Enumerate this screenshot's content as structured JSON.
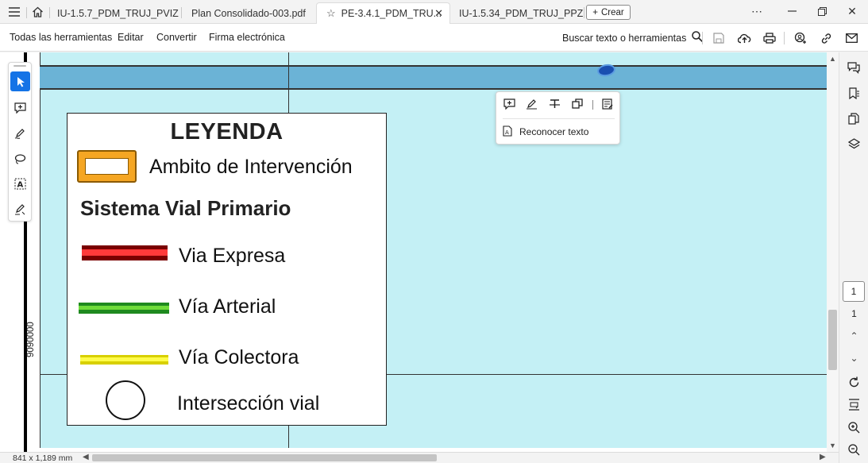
{
  "tabs": [
    {
      "label": "IU-1.5.7_PDM_TRUJ_PVIZ...",
      "active": false
    },
    {
      "label": "Plan Consolidado-003.pdf",
      "active": false
    },
    {
      "label": "PE-3.4.1_PDM_TRU...",
      "active": true
    },
    {
      "label": "IU-1.5.34_PDM_TRUJ_PPZ...",
      "active": false
    }
  ],
  "crear_label": "Crear",
  "menu": {
    "all_tools": "Todas las herramientas",
    "edit": "Editar",
    "convert": "Convertir",
    "esign": "Firma electrónica"
  },
  "search_label": "Buscar texto o herramientas",
  "document": {
    "coordinate_label": "9090000",
    "legend": {
      "title": "LEYENDA",
      "ambito": "Ambito de Intervención",
      "section_title": "Sistema Vial Primario",
      "expresa": "Via Expresa",
      "arterial": "Vía Arterial",
      "colectora": "Vía Colectora",
      "interseccion": "Intersección vial"
    }
  },
  "float_toolbar": {
    "ocr_label": "Reconocer texto"
  },
  "pagination": {
    "current": "1",
    "total": "1"
  },
  "status": {
    "page_size": "841 x 1,189 mm"
  },
  "colors": {
    "accent": "#1473e6",
    "map_background": "#c4f0f5",
    "band": "#6bb3d6"
  }
}
